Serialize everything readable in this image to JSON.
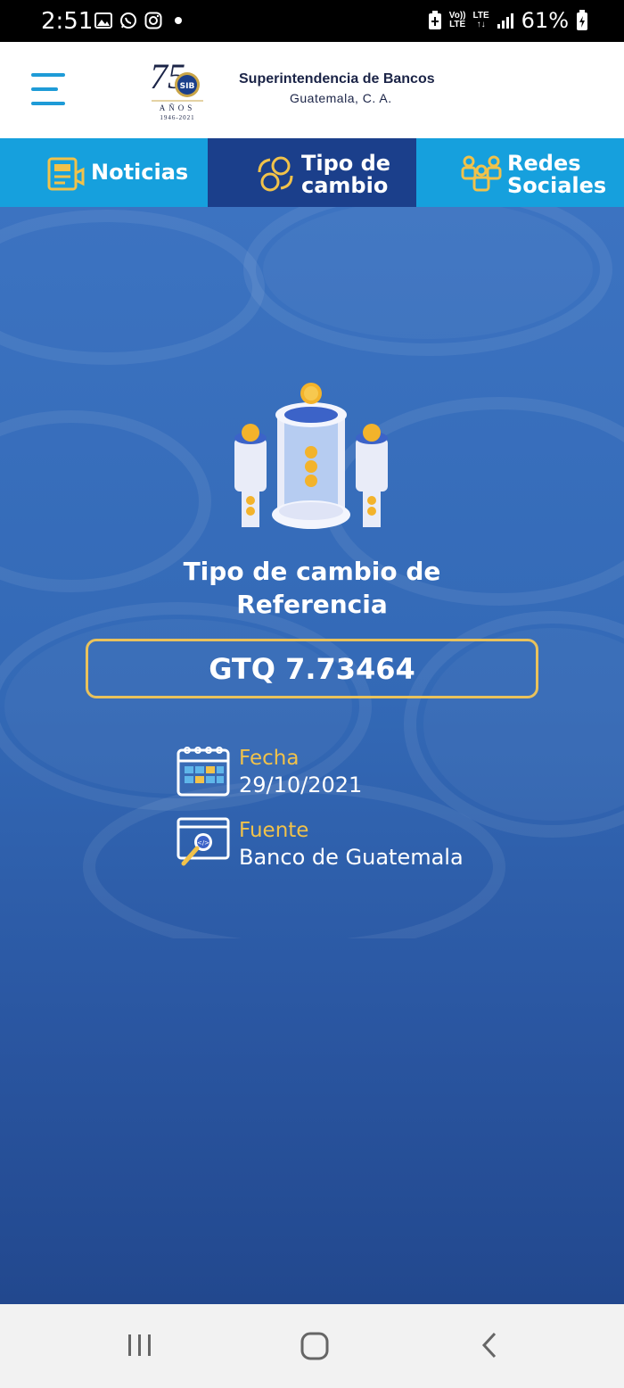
{
  "status_bar": {
    "time": "2:51",
    "battery": "61%",
    "lte_top": "Vo))",
    "lte_bottom": "LTE",
    "lte2_top": "LTE",
    "lte2_bottom": "↑↓"
  },
  "header": {
    "logo_text": "75",
    "logo_badge": "SIB",
    "logo_years": "AÑOS",
    "logo_range": "1946-2021",
    "org_name": "Superintendencia de Bancos",
    "org_location": "Guatemala, C. A."
  },
  "tabs": [
    {
      "label_line1": "Noticias",
      "label_line2": "",
      "icon": "newspaper-icon",
      "active": false
    },
    {
      "label_line1": "Tipo de",
      "label_line2": "cambio",
      "icon": "exchange-icon",
      "active": true
    },
    {
      "label_line1": "Redes",
      "label_line2": "Sociales",
      "icon": "people-icon",
      "active": false
    }
  ],
  "main": {
    "title_line1": "Tipo de cambio de",
    "title_line2": "Referencia",
    "rate": "GTQ 7.73464",
    "date_label": "Fecha",
    "date_value": "29/10/2021",
    "source_label": "Fuente",
    "source_value": "Banco de Guatemala"
  },
  "colors": {
    "accent_blue": "#16a0dd",
    "active_tab": "#1b3f8b",
    "gold": "#e9c25c"
  }
}
